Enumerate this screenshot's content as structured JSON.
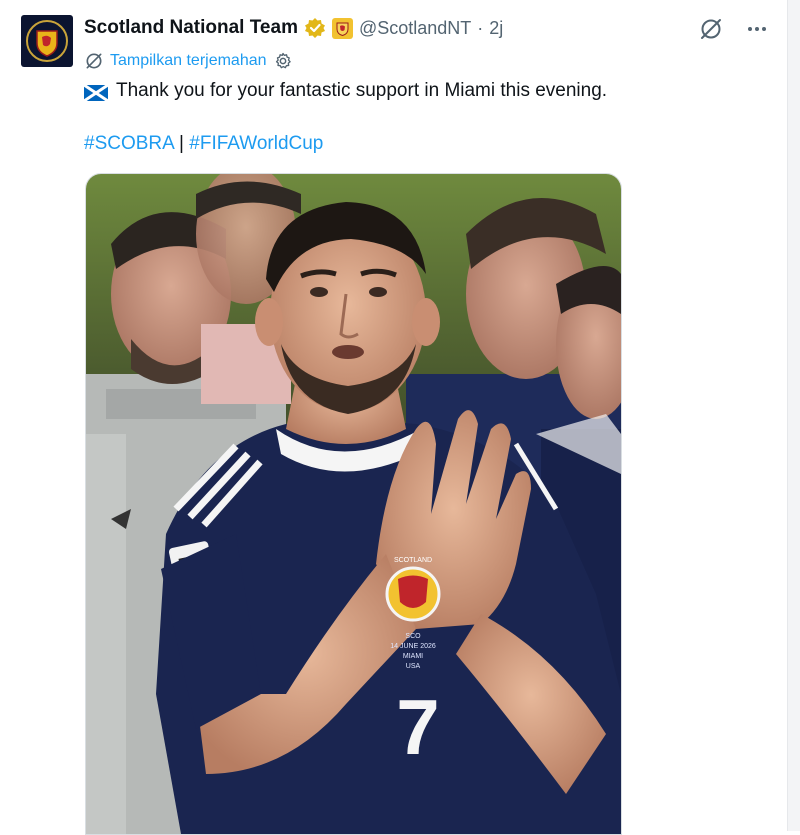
{
  "author": {
    "display_name": "Scotland National Team",
    "handle": "@ScotlandNT",
    "separator": "·",
    "time": "2j",
    "avatar_icon": "scotland-crest-icon",
    "verified_badge": "gold-verified-badge-icon",
    "affiliate_badge": "affiliate-badge-icon"
  },
  "translate": {
    "label": "Tampilkan terjemahan",
    "icon": "translate-icon",
    "settings_icon": "gear-icon"
  },
  "tweet": {
    "flag_icon": "scotland-flag-icon",
    "text": "Thank you for your fantastic support in Miami this evening.",
    "hashtags": [
      "#SCOBRA",
      "#FIFAWorldCup"
    ],
    "hashtag_separator": "|"
  },
  "media": {
    "jersey_number": "7",
    "shirt_text": [
      "SCOTLAND",
      "SCO",
      "14 JUNE 2026",
      "MIAMI",
      "USA"
    ],
    "sleeve_patch": "2026"
  },
  "actions": {
    "grok_icon": "grok-icon",
    "more_icon": "more-dots-icon",
    "more_label": "···"
  },
  "colors": {
    "accent": "#1d9bf0",
    "text": "#0f1419",
    "muted": "#536471",
    "gold": "#e9b419",
    "navy": "#141c3c"
  }
}
